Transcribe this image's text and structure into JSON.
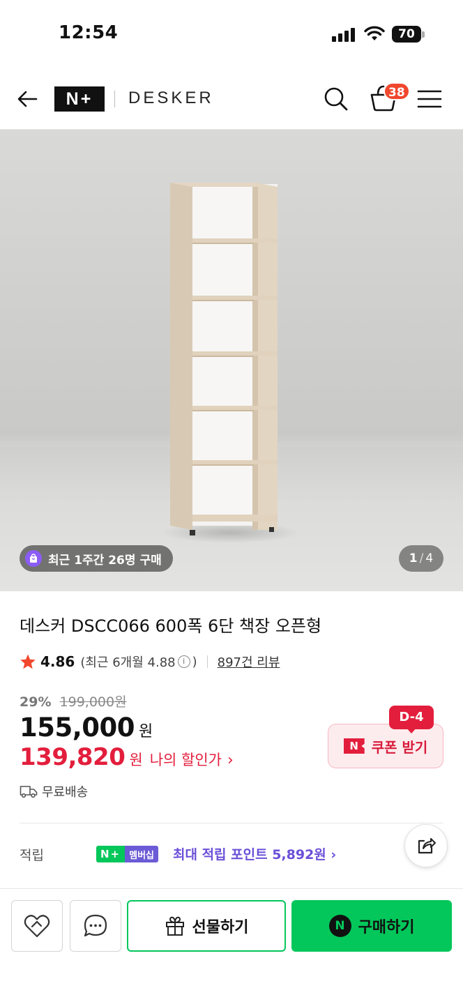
{
  "status_bar": {
    "time": "12:54",
    "battery": "70"
  },
  "header": {
    "logo": "N+",
    "brand": "DESKER",
    "cart_count": "38"
  },
  "hero": {
    "purchase_badge": "최근 1주간 26명 구매",
    "current_image": "1",
    "total_images": "4",
    "separator": "/"
  },
  "product": {
    "title": "데스커 DSCC066 600폭 6단 책장 오픈형",
    "rating": "4.86",
    "recent_rating_prefix": "(최근 6개월 4.88",
    "recent_rating_suffix": ")",
    "info_icon": "i",
    "review_count": "897건 리뷰",
    "discount_rate": "29%",
    "original_price": "199,000원",
    "price": "155,000",
    "price_unit": "원",
    "my_price": "139,820",
    "my_price_unit": "원",
    "my_price_label": "나의 할인가",
    "my_price_chevron": "›",
    "shipping": "무료배송"
  },
  "coupon": {
    "label": "쿠폰 받기",
    "dday": "D-4",
    "logo": "N"
  },
  "points": {
    "label": "적립",
    "chip_np": "N+",
    "chip_member": "멤버십",
    "text": "최대 적립 포인트 5,892원 ›"
  },
  "bottom_bar": {
    "gift_label": "선물하기",
    "buy_label": "구매하기",
    "buy_logo": "N"
  },
  "colors": {
    "accent_green": "#03c75a",
    "price_red": "#e31e3c",
    "membership_purple": "#6b4fd8",
    "badge_orange": "#f0472d"
  },
  "icons": [
    "back-arrow-icon",
    "search-icon",
    "cart-icon",
    "menu-icon",
    "star-icon",
    "info-icon",
    "truck-icon",
    "share-icon",
    "heart-icon",
    "chat-icon",
    "gift-icon"
  ]
}
